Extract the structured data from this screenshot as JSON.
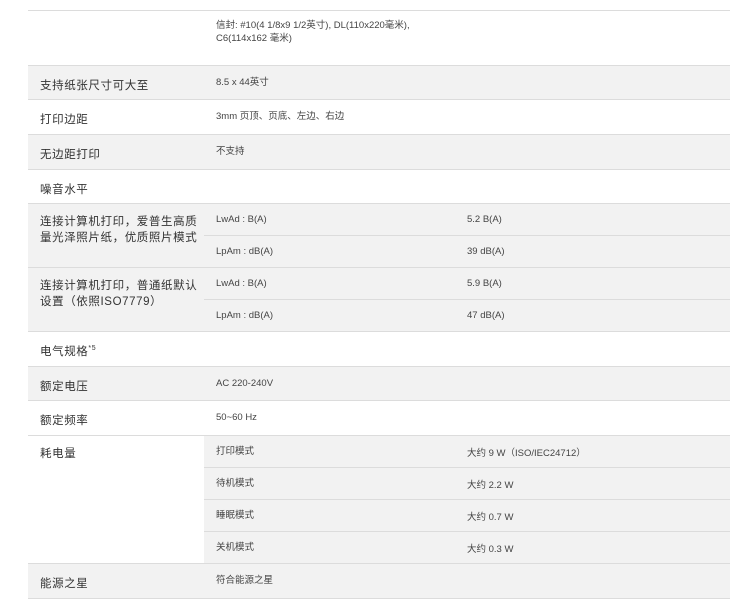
{
  "rows": [
    {
      "value": "信封: #10(4 1/8x9 1/2英寸), DL(110x220毫米), C6(114x162 毫米)"
    },
    {
      "label": "支持纸张尺寸可大至",
      "value": "8.5 x 44英寸"
    },
    {
      "label": "打印边距",
      "value": "3mm 页顶、页底、左边、右边"
    },
    {
      "label": "无边距打印",
      "value": "不支持"
    },
    {
      "label": "噪音水平"
    },
    {
      "label": "连接计算机打印，爱普生高质量光泽照片纸，优质照片模式",
      "subs": [
        {
          "name": "LwAd : B(A)",
          "value": "5.2 B(A)"
        },
        {
          "name": "LpAm : dB(A)",
          "value": "39 dB(A)"
        }
      ]
    },
    {
      "label": "连接计算机打印，普通纸默认设置（依照ISO7779）",
      "subs": [
        {
          "name": "LwAd : B(A)",
          "value": "5.9 B(A)"
        },
        {
          "name": "LpAm : dB(A)",
          "value": "47 dB(A)"
        }
      ]
    },
    {
      "label": "电气规格",
      "sup": "*5"
    },
    {
      "label": "额定电压",
      "value": "AC 220-240V"
    },
    {
      "label": "额定频率",
      "value": "50~60 Hz"
    },
    {
      "label": "耗电量",
      "subs": [
        {
          "name": "打印模式",
          "value": "大约 9 W（ISO/IEC24712）"
        },
        {
          "name": "待机模式",
          "value": "大约 2.2 W"
        },
        {
          "name": "睡眠模式",
          "value": "大约 0.7 W"
        },
        {
          "name": "关机模式",
          "value": "大约 0.3 W"
        }
      ]
    },
    {
      "label": "能源之星",
      "value": "符合能源之星"
    }
  ]
}
